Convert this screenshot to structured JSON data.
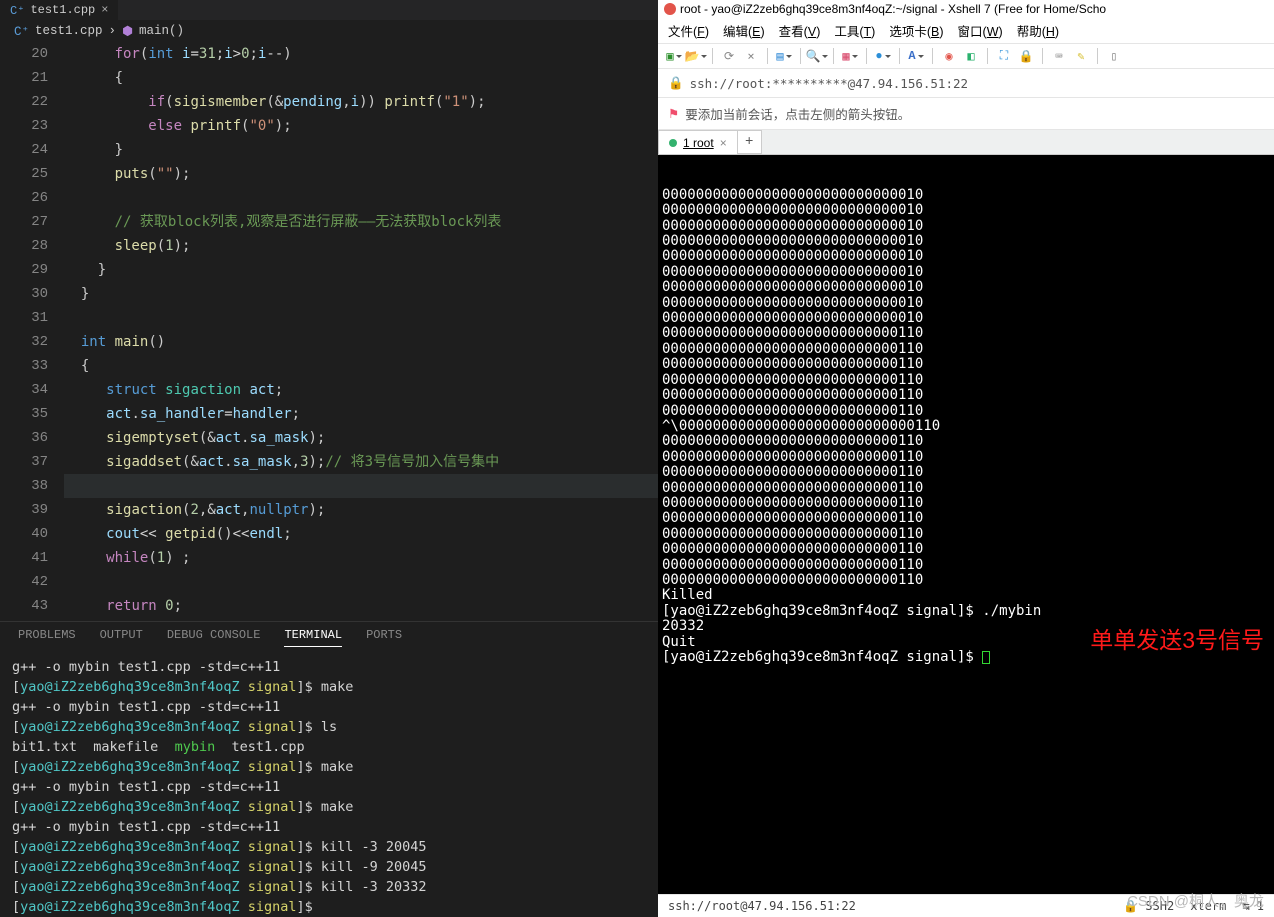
{
  "vscode": {
    "tab_file": "test1.cpp",
    "breadcrumb_file": "test1.cpp",
    "breadcrumb_symbol": "main()",
    "panel_tabs": [
      "PROBLEMS",
      "OUTPUT",
      "DEBUG CONSOLE",
      "TERMINAL",
      "PORTS"
    ],
    "gutter": [
      "20",
      "21",
      "22",
      "23",
      "24",
      "25",
      "26",
      "27",
      "28",
      "29",
      "30",
      "31",
      "32",
      "33",
      "34",
      "35",
      "36",
      "37",
      "38",
      "39",
      "40",
      "41",
      "42",
      "43"
    ],
    "code_rows": [
      [
        [
          "pn",
          "      "
        ],
        [
          "kw2",
          "for"
        ],
        [
          "pn",
          "("
        ],
        [
          "k",
          "int"
        ],
        [
          "pn",
          " "
        ],
        [
          "va",
          "i"
        ],
        [
          "op",
          "="
        ],
        [
          "nu",
          "31"
        ],
        [
          "pn",
          ";"
        ],
        [
          "va",
          "i"
        ],
        [
          "op",
          ">"
        ],
        [
          "nu",
          "0"
        ],
        [
          "pn",
          ";"
        ],
        [
          "va",
          "i"
        ],
        [
          "op",
          "--"
        ],
        [
          "pn",
          ")"
        ]
      ],
      [
        [
          "pn",
          "      {"
        ]
      ],
      [
        [
          "pn",
          "          "
        ],
        [
          "kw2",
          "if"
        ],
        [
          "pn",
          "("
        ],
        [
          "fn",
          "sigismember"
        ],
        [
          "pn",
          "(&"
        ],
        [
          "va",
          "pending"
        ],
        [
          "pn",
          ","
        ],
        [
          "va",
          "i"
        ],
        [
          "pn",
          ")) "
        ],
        [
          "fn",
          "printf"
        ],
        [
          "pn",
          "("
        ],
        [
          "st",
          "\"1\""
        ],
        [
          "pn",
          ");"
        ]
      ],
      [
        [
          "pn",
          "          "
        ],
        [
          "kw2",
          "else"
        ],
        [
          "pn",
          " "
        ],
        [
          "fn",
          "printf"
        ],
        [
          "pn",
          "("
        ],
        [
          "st",
          "\"0\""
        ],
        [
          "pn",
          ");"
        ]
      ],
      [
        [
          "pn",
          "      }"
        ]
      ],
      [
        [
          "pn",
          "      "
        ],
        [
          "fn",
          "puts"
        ],
        [
          "pn",
          "("
        ],
        [
          "st",
          "\"\""
        ],
        [
          "pn",
          ");"
        ]
      ],
      [
        [
          "pn",
          ""
        ]
      ],
      [
        [
          "pn",
          "      "
        ],
        [
          "cm",
          "// 获取block列表,观察是否进行屏蔽——无法获取block列表"
        ]
      ],
      [
        [
          "pn",
          "      "
        ],
        [
          "fn",
          "sleep"
        ],
        [
          "pn",
          "("
        ],
        [
          "nu",
          "1"
        ],
        [
          "pn",
          ");"
        ]
      ],
      [
        [
          "pn",
          "    }"
        ]
      ],
      [
        [
          "pn",
          "  }"
        ]
      ],
      [
        [
          "pn",
          ""
        ]
      ],
      [
        [
          "pn",
          "  "
        ],
        [
          "k",
          "int"
        ],
        [
          "pn",
          " "
        ],
        [
          "fn",
          "main"
        ],
        [
          "pn",
          "()"
        ]
      ],
      [
        [
          "pn",
          "  {"
        ]
      ],
      [
        [
          "pn",
          "     "
        ],
        [
          "k",
          "struct"
        ],
        [
          "pn",
          " "
        ],
        [
          "ty",
          "sigaction"
        ],
        [
          "pn",
          " "
        ],
        [
          "va",
          "act"
        ],
        [
          "pn",
          ";"
        ]
      ],
      [
        [
          "pn",
          "     "
        ],
        [
          "va",
          "act"
        ],
        [
          "pn",
          "."
        ],
        [
          "va",
          "sa_handler"
        ],
        [
          "op",
          "="
        ],
        [
          "va",
          "handler"
        ],
        [
          "pn",
          ";"
        ]
      ],
      [
        [
          "pn",
          "     "
        ],
        [
          "fn",
          "sigemptyset"
        ],
        [
          "pn",
          "(&"
        ],
        [
          "va",
          "act"
        ],
        [
          "pn",
          "."
        ],
        [
          "va",
          "sa_mask"
        ],
        [
          "pn",
          ");"
        ]
      ],
      [
        [
          "pn",
          "     "
        ],
        [
          "fn",
          "sigaddset"
        ],
        [
          "pn",
          "(&"
        ],
        [
          "va",
          "act"
        ],
        [
          "pn",
          "."
        ],
        [
          "va",
          "sa_mask"
        ],
        [
          "pn",
          ","
        ],
        [
          "nu",
          "3"
        ],
        [
          "pn",
          ");"
        ],
        [
          "cm",
          "// 将3号信号加入信号集中"
        ]
      ],
      [
        [
          "pn",
          ""
        ]
      ],
      [
        [
          "pn",
          "     "
        ],
        [
          "fn",
          "sigaction"
        ],
        [
          "pn",
          "("
        ],
        [
          "nu",
          "2"
        ],
        [
          "pn",
          ",&"
        ],
        [
          "va",
          "act"
        ],
        [
          "pn",
          ","
        ],
        [
          "k",
          "nullptr"
        ],
        [
          "pn",
          ");"
        ]
      ],
      [
        [
          "pn",
          "     "
        ],
        [
          "va",
          "cout"
        ],
        [
          "op",
          "<< "
        ],
        [
          "fn",
          "getpid"
        ],
        [
          "pn",
          "()"
        ],
        [
          "op",
          "<<"
        ],
        [
          "va",
          "endl"
        ],
        [
          "pn",
          ";"
        ]
      ],
      [
        [
          "pn",
          "     "
        ],
        [
          "kw2",
          "while"
        ],
        [
          "pn",
          "("
        ],
        [
          "nu",
          "1"
        ],
        [
          "pn",
          ") ;"
        ]
      ],
      [
        [
          "pn",
          ""
        ]
      ],
      [
        [
          "pn",
          "     "
        ],
        [
          "kw2",
          "return"
        ],
        [
          "pn",
          " "
        ],
        [
          "nu",
          "0"
        ],
        [
          "pn",
          ";"
        ]
      ]
    ],
    "terminal_rows": [
      [
        [
          "op",
          "g++ -o mybin test1.cpp -std=c++11"
        ]
      ],
      [
        [
          "op",
          "["
        ],
        [
          "cy",
          "yao@iZ2zeb6ghq39ce8m3nf4oqZ"
        ],
        [
          "op",
          " "
        ],
        [
          "ye",
          "signal"
        ],
        [
          "op",
          "]$ make"
        ]
      ],
      [
        [
          "op",
          "g++ -o mybin test1.cpp -std=c++11"
        ]
      ],
      [
        [
          "op",
          "["
        ],
        [
          "cy",
          "yao@iZ2zeb6ghq39ce8m3nf4oqZ"
        ],
        [
          "op",
          " "
        ],
        [
          "ye",
          "signal"
        ],
        [
          "op",
          "]$ ls"
        ]
      ],
      [
        [
          "op",
          "bit1.txt  makefile  "
        ],
        [
          "gr",
          "mybin"
        ],
        [
          "op",
          "  test1.cpp"
        ]
      ],
      [
        [
          "op",
          "["
        ],
        [
          "cy",
          "yao@iZ2zeb6ghq39ce8m3nf4oqZ"
        ],
        [
          "op",
          " "
        ],
        [
          "ye",
          "signal"
        ],
        [
          "op",
          "]$ make"
        ]
      ],
      [
        [
          "op",
          "g++ -o mybin test1.cpp -std=c++11"
        ]
      ],
      [
        [
          "op",
          "["
        ],
        [
          "cy",
          "yao@iZ2zeb6ghq39ce8m3nf4oqZ"
        ],
        [
          "op",
          " "
        ],
        [
          "ye",
          "signal"
        ],
        [
          "op",
          "]$ make"
        ]
      ],
      [
        [
          "op",
          "g++ -o mybin test1.cpp -std=c++11"
        ]
      ],
      [
        [
          "op",
          "["
        ],
        [
          "cy",
          "yao@iZ2zeb6ghq39ce8m3nf4oqZ"
        ],
        [
          "op",
          " "
        ],
        [
          "ye",
          "signal"
        ],
        [
          "op",
          "]$ kill -3 20045"
        ]
      ],
      [
        [
          "op",
          "["
        ],
        [
          "cy",
          "yao@iZ2zeb6ghq39ce8m3nf4oqZ"
        ],
        [
          "op",
          " "
        ],
        [
          "ye",
          "signal"
        ],
        [
          "op",
          "]$ kill -9 20045"
        ]
      ],
      [
        [
          "op",
          "["
        ],
        [
          "cy",
          "yao@iZ2zeb6ghq39ce8m3nf4oqZ"
        ],
        [
          "op",
          " "
        ],
        [
          "ye",
          "signal"
        ],
        [
          "op",
          "]$ kill -3 20332"
        ]
      ],
      [
        [
          "op",
          "["
        ],
        [
          "cy",
          "yao@iZ2zeb6ghq39ce8m3nf4oqZ"
        ],
        [
          "op",
          " "
        ],
        [
          "ye",
          "signal"
        ],
        [
          "op",
          "]$ "
        ]
      ]
    ]
  },
  "xshell": {
    "title": "root - yao@iZ2zeb6ghq39ce8m3nf4oqZ:~/signal - Xshell 7 (Free for Home/Scho",
    "menu": [
      {
        "l": "文件",
        "u": "F"
      },
      {
        "l": "编辑",
        "u": "E"
      },
      {
        "l": "查看",
        "u": "V"
      },
      {
        "l": "工具",
        "u": "T"
      },
      {
        "l": "选项卡",
        "u": "B"
      },
      {
        "l": "窗口",
        "u": "W"
      },
      {
        "l": "帮助",
        "u": "H"
      }
    ],
    "address": "ssh://root:**********@47.94.156.51:22",
    "tip": "要添加当前会话，点击左侧的箭头按钮。",
    "session_tab": "1 root",
    "terminal_lines": [
      "0000000000000000000000000000010",
      "0000000000000000000000000000010",
      "0000000000000000000000000000010",
      "0000000000000000000000000000010",
      "0000000000000000000000000000010",
      "0000000000000000000000000000010",
      "0000000000000000000000000000010",
      "0000000000000000000000000000010",
      "0000000000000000000000000000010",
      "0000000000000000000000000000110",
      "0000000000000000000000000000110",
      "0000000000000000000000000000110",
      "0000000000000000000000000000110",
      "0000000000000000000000000000110",
      "0000000000000000000000000000110",
      "^\\0000000000000000000000000000110",
      "0000000000000000000000000000110",
      "0000000000000000000000000000110",
      "0000000000000000000000000000110",
      "0000000000000000000000000000110",
      "0000000000000000000000000000110",
      "0000000000000000000000000000110",
      "0000000000000000000000000000110",
      "0000000000000000000000000000110",
      "0000000000000000000000000000110",
      "0000000000000000000000000000110",
      "Killed",
      "[yao@iZ2zeb6ghq39ce8m3nf4oqZ signal]$ ./mybin",
      "20332",
      "Quit",
      "[yao@iZ2zeb6ghq39ce8m3nf4oqZ signal]$ "
    ],
    "annotation": "单单发送3号信号",
    "status_left": "ssh://root@47.94.156.51:22",
    "status_ssh": "SSH2",
    "status_term": "xterm",
    "status_r": "1"
  },
  "watermark": "CSDN @桐人，奥龙"
}
